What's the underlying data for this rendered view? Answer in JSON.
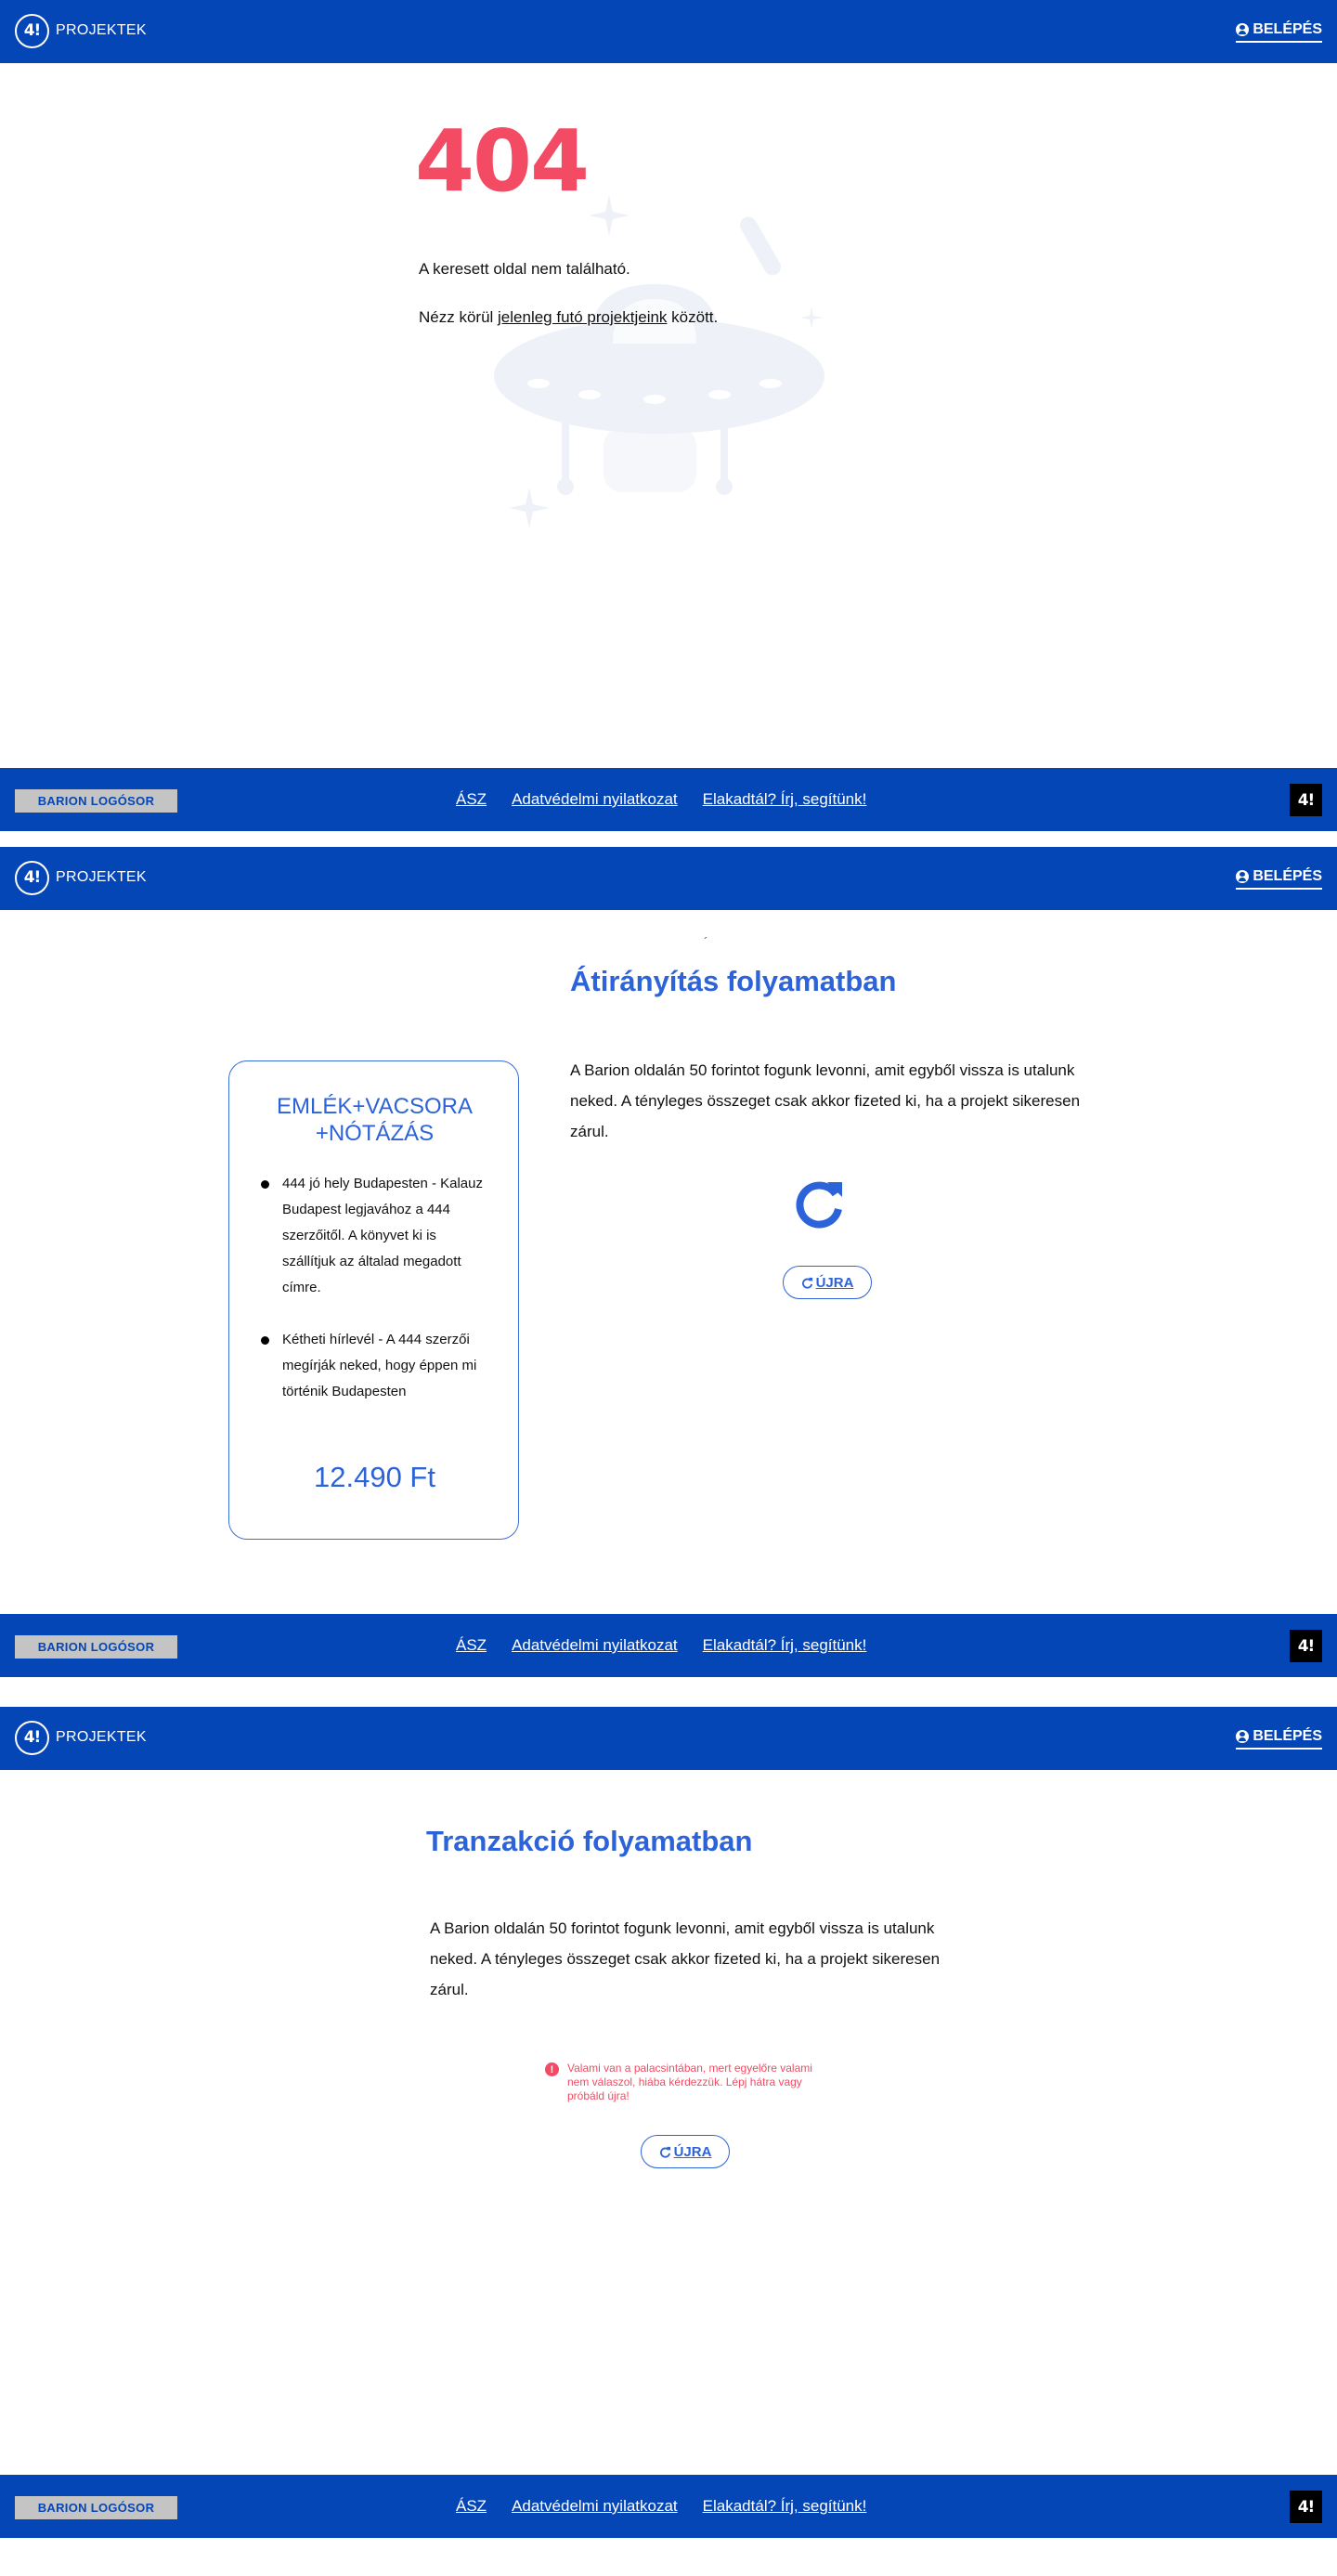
{
  "header": {
    "brand": "PROJEKTEK",
    "login": "BELÉPÉS"
  },
  "footer": {
    "barion": "BARION LOGÓSOR",
    "links": [
      "ÁSZ",
      "Adatvédelmi nyilatkozat",
      "Elakadtál? Írj, segítünk!"
    ]
  },
  "notfound": {
    "code": "404",
    "message": "A keresett oldal nem található.",
    "nav_prefix": "Nézz körül ",
    "nav_link": "jelenleg futó projektjeink",
    "nav_suffix": " között."
  },
  "redirect": {
    "title": "Átirányítás folyamatban",
    "paragraph": "A Barion oldalán 50 forintot fogunk levonni, amit egyből vissza is utalunk neked. A tényleges összeget csak akkor fizeted ki, ha a projekt sikeresen zárul.",
    "retry": "ÚJRA",
    "card": {
      "title": "EMLÉK+VACSORA +NÓTÁZÁS",
      "items": [
        "444 jó hely Budapesten - Kalauz Budapest legjavához a 444 szerzőitől. A könyvet ki is szállítjuk az általad megadott címre.",
        "Kétheti hírlevél - A 444 szerzői megírják neked, hogy éppen mi történik Budapesten"
      ],
      "price": "12.490 Ft"
    }
  },
  "transaction": {
    "title": "Tranzakció folyamatban",
    "paragraph": "A Barion oldalán 50 forintot fogunk levonni, amit egyből vissza is utalunk neked. A tényleges összeget csak akkor fizeted ki, ha a projekt sikeresen zárul.",
    "error": "Valami van a palacsintában, mert egyelőre valami nem válaszol, hiába kérdezzük. Lépj hátra vagy próbáld újra!",
    "retry": "ÚJRA"
  },
  "colors": {
    "brand_blue": "#0546b7",
    "accent_blue": "#2d63d8",
    "error_red": "#f24b63"
  },
  "icons": [
    "logo-icon",
    "user-icon",
    "ufo-illustration",
    "refresh-icon",
    "error-icon"
  ]
}
